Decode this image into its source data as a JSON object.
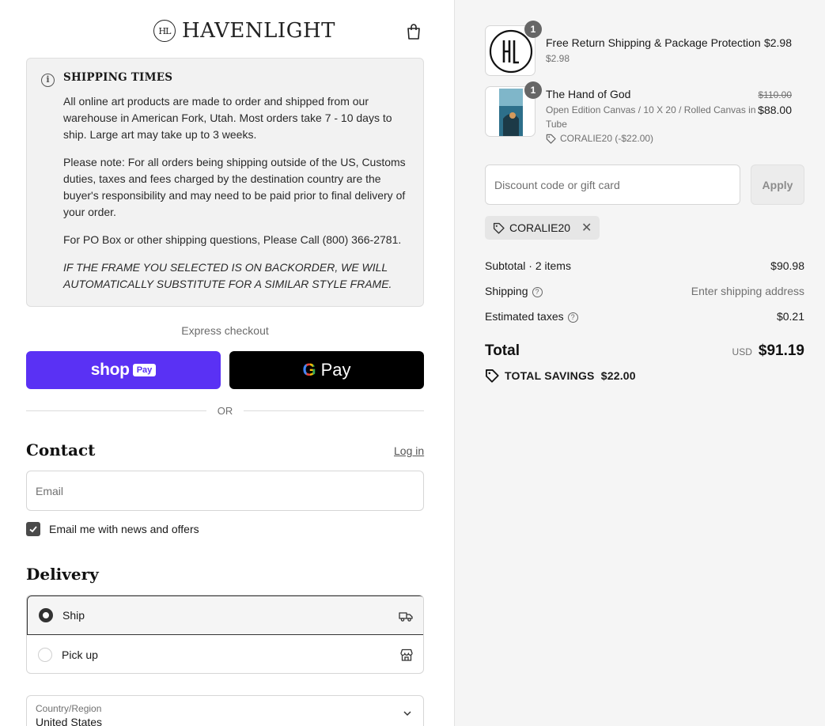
{
  "brand": {
    "monogram": "HL",
    "name": "HAVENLIGHT"
  },
  "notice": {
    "title": "SHIPPING TIMES",
    "p1": "All online art products are made to order and shipped from our warehouse in American Fork, Utah. Most orders take 7 - 10 days to ship. Large art may take up to 3 weeks.",
    "p2": "Please note: For all orders being shipping outside of the US, Customs duties, taxes and fees charged by the destination country are the buyer's responsibility and may need to be paid prior to final delivery of your order.",
    "p3": "For PO Box or other shipping questions, Please Call (800) 366-2781.",
    "p4": "IF THE FRAME YOU SELECTED IS ON BACKORDER, WE WILL AUTOMATICALLY SUBSTITUTE FOR A SIMILAR STYLE FRAME."
  },
  "express": {
    "label": "Express checkout",
    "shop_word": "shop",
    "shop_pay": "Pay",
    "gpay_g": "G",
    "gpay_pay": "Pay",
    "or": "OR"
  },
  "contact": {
    "title": "Contact",
    "login": "Log in",
    "email_placeholder": "Email",
    "newsletter_label": "Email me with news and offers",
    "newsletter_checked": true
  },
  "delivery": {
    "title": "Delivery",
    "options": [
      {
        "label": "Ship",
        "selected": true
      },
      {
        "label": "Pick up",
        "selected": false
      }
    ],
    "country_label": "Country/Region",
    "country_value": "United States"
  },
  "summary": {
    "items": [
      {
        "name": "Free Return Shipping & Package Protection",
        "sub": "$2.98",
        "price": "$2.98",
        "qty": "1"
      },
      {
        "name": "The Hand of God",
        "sub": "Open Edition Canvas / 10 X 20 / Rolled Canvas in Tube",
        "original_price": "$110.00",
        "price": "$88.00",
        "discount": "CORALIE20 (-$22.00)",
        "qty": "1"
      }
    ],
    "discount_placeholder": "Discount code or gift card",
    "apply": "Apply",
    "applied_code": "CORALIE20",
    "subtotal_label": "Subtotal · 2 items",
    "subtotal_value": "$90.98",
    "shipping_label": "Shipping",
    "shipping_value": "Enter shipping address",
    "taxes_label": "Estimated taxes",
    "taxes_value": "$0.21",
    "total_label": "Total",
    "currency": "USD",
    "total_value": "$91.19",
    "savings": "TOTAL SAVINGS  $22.00"
  },
  "colors": {
    "shop_purple": "#5a31f4",
    "panel_gray": "#f5f5f5"
  }
}
